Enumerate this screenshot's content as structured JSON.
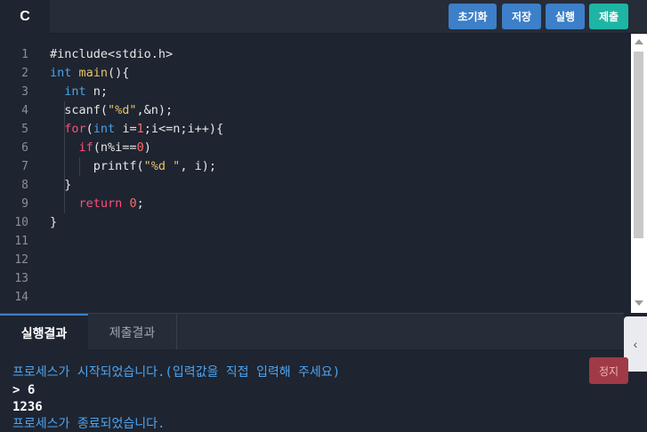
{
  "toolbar": {
    "language": "C",
    "reset_label": "초기화",
    "save_label": "저장",
    "run_label": "실행",
    "submit_label": "제출"
  },
  "editor": {
    "line_numbers": [
      "1",
      "2",
      "3",
      "4",
      "5",
      "6",
      "7",
      "8",
      "9",
      "10",
      "11",
      "12",
      "13",
      "14"
    ],
    "lines": [
      "#include<stdio.h>",
      "int main(){",
      "  int n;",
      "  scanf(\"%d\",&n);",
      "  for(int i=1;i<=n;i++){",
      "    if(n%i==0)",
      "      printf(\"%d \", i);",
      "  }",
      "    return 0;",
      "}",
      "",
      "",
      "",
      ""
    ]
  },
  "output": {
    "tabs": [
      {
        "label": "실행결과",
        "active": true
      },
      {
        "label": "제출결과",
        "active": false
      }
    ],
    "stop_label": "정지",
    "console_lines": [
      {
        "kind": "system",
        "text": "프로세스가 시작되었습니다.(입력값을 직접 입력해 주세요)"
      },
      {
        "kind": "input",
        "text": "> 6"
      },
      {
        "kind": "output",
        "text": "1236"
      },
      {
        "kind": "system",
        "text": "프로세스가 종료되었습니다."
      }
    ]
  },
  "colors": {
    "keyword": "#4aa3e8",
    "function": "#e8c46a",
    "number": "#ff6b6b",
    "control": "#ff4f78",
    "system_text": "#4ea4ef",
    "submit_button": "#1eb5a4",
    "primary_button": "#3d7fc8",
    "stop_button": "#a03a44"
  },
  "icons": {
    "collapse_handle": "chevron-left-icon"
  }
}
